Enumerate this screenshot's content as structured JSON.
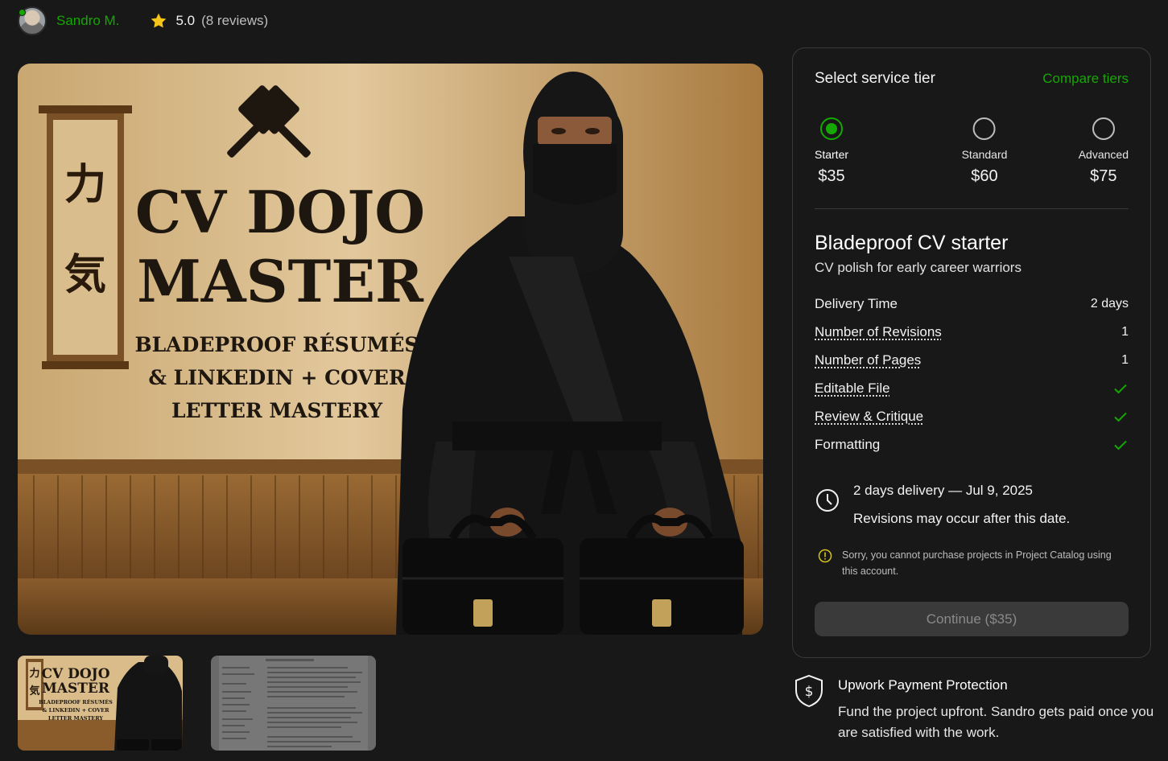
{
  "seller": {
    "name": "Sandro M.",
    "status": "online"
  },
  "rating": {
    "value": "5.0",
    "count_text": "(8 reviews)",
    "star_color": "#f5c518"
  },
  "gallery": {
    "hero": {
      "title_line1": "CV DOJO",
      "title_line2": "MASTER",
      "tagline_line1": "BLADEPROOF RÉSUMÉS",
      "tagline_line2": "& LINKEDIN + COVER",
      "tagline_line3": "LETTER MASTERY",
      "scroll_glyph1": "力",
      "scroll_glyph2": "気"
    },
    "thumbnails": [
      {
        "kind": "cover-image",
        "selected": true
      },
      {
        "kind": "resume-sample",
        "selected": false
      }
    ]
  },
  "tier_card": {
    "title": "Select service tier",
    "compare_link": "Compare tiers",
    "tiers": [
      {
        "name": "Starter",
        "price": "$35",
        "selected": true
      },
      {
        "name": "Standard",
        "price": "$60",
        "selected": false
      },
      {
        "name": "Advanced",
        "price": "$75",
        "selected": false
      }
    ],
    "package_title": "Bladeproof CV starter",
    "package_subtitle": "CV polish for early career warriors",
    "features": [
      {
        "label": "Delivery Time",
        "value": "2 days"
      },
      {
        "label": "Number of Revisions",
        "value": "1"
      },
      {
        "label": "Number of Pages",
        "value": "1"
      },
      {
        "label": "Editable File",
        "value": "check-icon"
      },
      {
        "label": "Review & Critique",
        "value": "check-icon"
      },
      {
        "label": "Formatting",
        "value": "check-icon"
      }
    ],
    "delivery_line1": "2 days delivery — Jul 9, 2025",
    "delivery_line2": "Revisions may occur after this date.",
    "notice": "Sorry, you cannot purchase projects in Project Catalog using this account.",
    "continue_label": "Continue ($35)"
  },
  "protection": {
    "title": "Upwork Payment Protection",
    "text": "Fund the project upfront. Sandro gets paid once you are satisfied with the work."
  },
  "colors": {
    "accent": "#14a800",
    "background": "#181818",
    "card_border": "#3a3a3a"
  }
}
